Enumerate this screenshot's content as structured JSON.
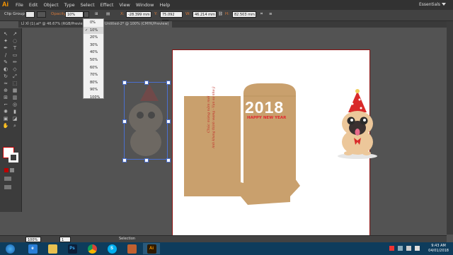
{
  "app": {
    "logo": "Ai"
  },
  "menu": [
    "File",
    "Edit",
    "Object",
    "Type",
    "Select",
    "Effect",
    "View",
    "Window",
    "Help"
  ],
  "workspace": {
    "label": "Essentials"
  },
  "window_controls": [
    "–",
    "□",
    "✕"
  ],
  "control_bar": {
    "selection_type": "Clip Group",
    "opacity_label": "Opacity:",
    "opacity_value": "10%",
    "x_label": "X:",
    "x_value": "-28.399 mm",
    "y_label": "Y:",
    "y_value": "75.092 mm",
    "w_label": "W:",
    "w_value": "46.214 mm",
    "h_label": "H:",
    "h_value": "82.503 mm"
  },
  "tabs": [
    {
      "label": "LÌ XÌ (1).ai* @ 46.67% (RGB/Previe...",
      "active": false
    },
    {
      "label": "Untitled-2* @ 100% (CMYK/Preview)",
      "active": true
    }
  ],
  "opacity_options": [
    "0%",
    "10%",
    "20%",
    "30%",
    "40%",
    "50%",
    "60%",
    "70%",
    "80%",
    "90%",
    "100%"
  ],
  "opacity_selected": "10%",
  "artwork": {
    "year": "2018",
    "greeting": "HAPPY NEW YEAR",
    "vertical_text_1": "Chúc mừng năm mới",
    "vertical_text_2": "Anh khang thịnh vượng - Vạn sự như ý",
    "colors": {
      "envelope": "#c9a06d",
      "accent": "#e2272e",
      "artboard_border": "#8a1010"
    }
  },
  "status_bar": {
    "zoom": "100%",
    "page": "1",
    "mode": "Selection"
  },
  "taskbar": {
    "apps": [
      {
        "name": "windows-start",
        "label": ""
      },
      {
        "name": "internet-explorer",
        "label": "e"
      },
      {
        "name": "file-explorer",
        "label": ""
      },
      {
        "name": "photoshop",
        "label": "Ps"
      },
      {
        "name": "chrome",
        "label": ""
      },
      {
        "name": "skype",
        "label": "S"
      },
      {
        "name": "unknown-app",
        "label": ""
      },
      {
        "name": "illustrator",
        "label": "Ai"
      }
    ],
    "time": "9:43 AM",
    "date": "04/01/2018"
  }
}
